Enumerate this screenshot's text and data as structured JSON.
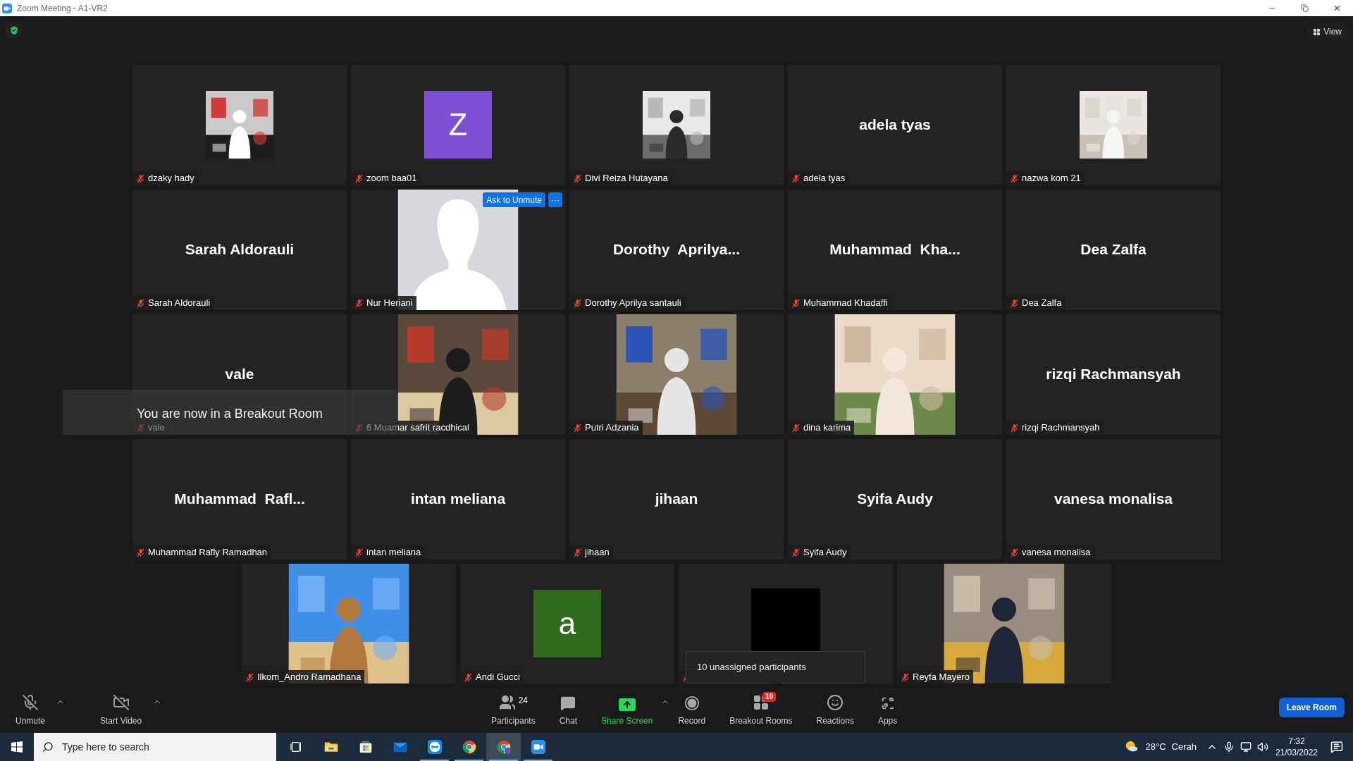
{
  "window": {
    "title": "Zoom Meeting - A1-VR2"
  },
  "top_bar": {
    "view_button": "View"
  },
  "rows": [
    {
      "tiles": [
        {
          "kind": "picture",
          "label": "dzaky hady",
          "muted": true
        },
        {
          "kind": "avatar",
          "letter": "Z",
          "color": "#7b4fd3",
          "label": "zoom baa01",
          "muted": true
        },
        {
          "kind": "picture",
          "label": "Divi Reiza Hutayana",
          "muted": true
        },
        {
          "kind": "name",
          "display_name": "adela tyas",
          "label": "adela tyas",
          "muted": true
        },
        {
          "kind": "picture",
          "label": "nazwa kom 21",
          "muted": true
        }
      ]
    },
    {
      "tiles": [
        {
          "kind": "name",
          "display_name": "Sarah Aldorauli",
          "label": "Sarah Aldorauli",
          "muted": true
        },
        {
          "kind": "silhouette",
          "label": "Nur Heriani",
          "muted": true,
          "actions": {
            "ask_button": "Ask to Unmute",
            "more_button": "···"
          }
        },
        {
          "kind": "name",
          "display_name": "Dorothy  Aprilya...",
          "label": "Dorothy Aprilya santauli",
          "muted": true
        },
        {
          "kind": "name",
          "display_name": "Muhammad  Kha...",
          "label": "Muhammad Khadaffi",
          "muted": true
        },
        {
          "kind": "name",
          "display_name": "Dea Zalfa",
          "label": "Dea Zalfa",
          "muted": true
        }
      ]
    },
    {
      "tiles": [
        {
          "kind": "name",
          "display_name": "vale",
          "label": "vale",
          "muted": true
        },
        {
          "kind": "picture",
          "label": "6 Muamar safrit racdhical",
          "muted": true
        },
        {
          "kind": "picture",
          "label": "Putri Adzania",
          "muted": true
        },
        {
          "kind": "picture",
          "label": "dina karima",
          "muted": true
        },
        {
          "kind": "name",
          "display_name": "rizqi Rachmansyah",
          "label": "rizqi Rachmansyah",
          "muted": true
        }
      ]
    },
    {
      "tiles": [
        {
          "kind": "name",
          "display_name": "Muhammad  Rafl...",
          "label": "Muhammad Rafly Ramadhan",
          "muted": true
        },
        {
          "kind": "name",
          "display_name": "intan meliana",
          "label": "intan meliana",
          "muted": true
        },
        {
          "kind": "name",
          "display_name": "jihaan",
          "label": "jihaan",
          "muted": true
        },
        {
          "kind": "name",
          "display_name": "Syifa Audy",
          "label": "Syifa Audy",
          "muted": true
        },
        {
          "kind": "name",
          "display_name": "vanesa monalisa",
          "label": "vanesa monalisa",
          "muted": true
        }
      ]
    },
    {
      "tiles": [
        {
          "kind": "picture",
          "label": "Ilkom_Andro Ramadhana",
          "muted": true
        },
        {
          "kind": "avatar",
          "letter": "a",
          "color": "#2f6b1c",
          "label": "Andi Gucci",
          "muted": true
        },
        {
          "kind": "black",
          "muted": true
        },
        {
          "kind": "picture",
          "label": "Reyfa Mayero",
          "muted": true
        }
      ]
    }
  ],
  "toast": "You are now in a Breakout Room",
  "tooltip": "10 unassigned participants",
  "toolbar": {
    "left": [
      {
        "kind": "mic",
        "label": "Unmute"
      },
      {
        "kind": "video",
        "label": "Start Video"
      }
    ],
    "center": [
      {
        "kind": "participants",
        "label": "Participants",
        "count": "24"
      },
      {
        "kind": "chat",
        "label": "Chat"
      },
      {
        "kind": "share",
        "label": "Share Screen"
      },
      {
        "kind": "record",
        "label": "Record"
      },
      {
        "kind": "breakout",
        "label": "Breakout Rooms",
        "badge": "10"
      },
      {
        "kind": "reactions",
        "label": "Reactions"
      },
      {
        "kind": "apps",
        "label": "Apps"
      }
    ],
    "leave_button": "Leave Room"
  },
  "taskbar": {
    "search_placeholder": "Type here to search",
    "apps": [
      {
        "kind": "taskview",
        "running": false,
        "selected": false
      },
      {
        "kind": "explorer",
        "running": false,
        "selected": false
      },
      {
        "kind": "store",
        "running": false,
        "selected": false
      },
      {
        "kind": "mail",
        "running": false,
        "selected": false
      },
      {
        "kind": "teamviewer",
        "running": true,
        "selected": false
      },
      {
        "kind": "chrome",
        "running": true,
        "selected": false
      },
      {
        "kind": "chrome-profile",
        "running": true,
        "selected": true
      },
      {
        "kind": "zoom",
        "running": true,
        "selected": false
      }
    ],
    "temperature": "28°C",
    "weather": "Cerah",
    "time": "7:32",
    "date": "21/03/2022"
  }
}
